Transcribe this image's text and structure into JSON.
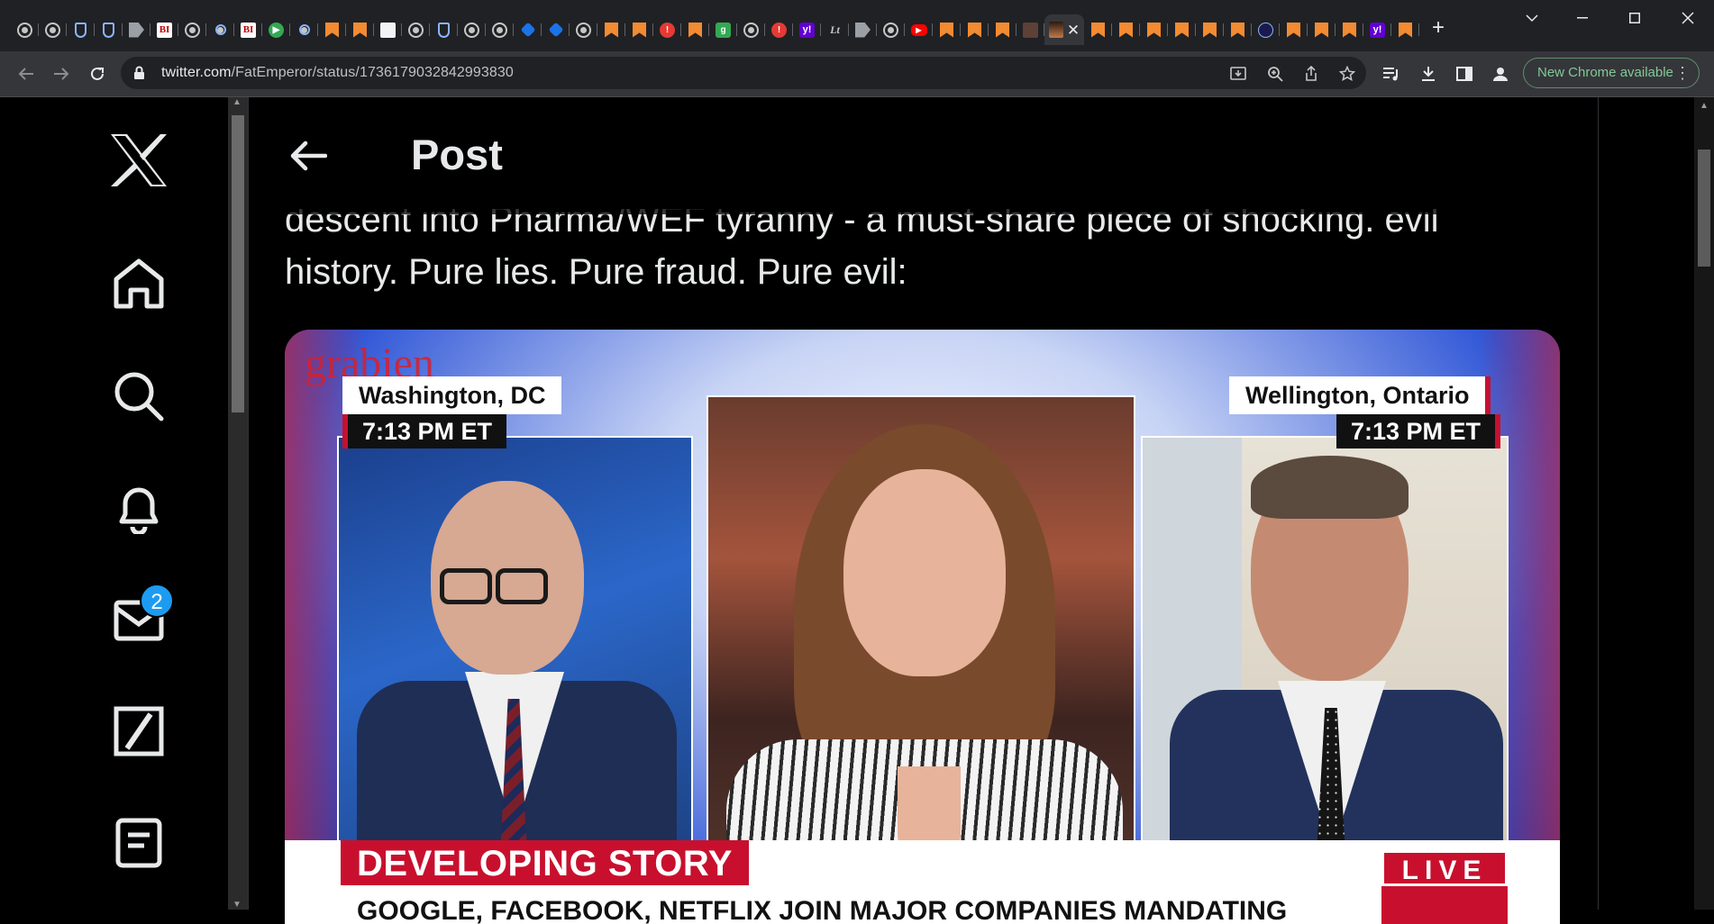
{
  "browser": {
    "tabs": [
      {
        "icon": "globe"
      },
      {
        "icon": "globe"
      },
      {
        "icon": "shield"
      },
      {
        "icon": "shield"
      },
      {
        "icon": "play"
      },
      {
        "icon": "bi",
        "glyph": "BI"
      },
      {
        "icon": "globe"
      },
      {
        "icon": "search"
      },
      {
        "icon": "bi",
        "glyph": "BI"
      },
      {
        "icon": "greenplay",
        "glyph": "▶"
      },
      {
        "icon": "search"
      },
      {
        "icon": "bm"
      },
      {
        "icon": "bm"
      },
      {
        "icon": "white"
      },
      {
        "icon": "globe"
      },
      {
        "icon": "shield"
      },
      {
        "icon": "globe"
      },
      {
        "icon": "globe"
      },
      {
        "icon": "cube"
      },
      {
        "icon": "cube"
      },
      {
        "icon": "globe"
      },
      {
        "icon": "bm"
      },
      {
        "icon": "bm"
      },
      {
        "icon": "red",
        "glyph": "!"
      },
      {
        "icon": "bm"
      },
      {
        "icon": "green",
        "glyph": "g"
      },
      {
        "icon": "globe"
      },
      {
        "icon": "red",
        "glyph": "!"
      },
      {
        "icon": "yahoo",
        "glyph": "y!"
      },
      {
        "icon": "text",
        "glyph": "Lt"
      },
      {
        "icon": "play"
      },
      {
        "icon": "globe"
      },
      {
        "icon": "yt",
        "glyph": "▶"
      },
      {
        "icon": "bm"
      },
      {
        "icon": "bm"
      },
      {
        "icon": "bm"
      },
      {
        "icon": "img"
      },
      {
        "icon": "active"
      },
      {
        "icon": "bm"
      },
      {
        "icon": "bm"
      },
      {
        "icon": "bm"
      },
      {
        "icon": "bm"
      },
      {
        "icon": "bm"
      },
      {
        "icon": "bm"
      },
      {
        "icon": "dark"
      },
      {
        "icon": "bm"
      },
      {
        "icon": "bm"
      },
      {
        "icon": "bm"
      },
      {
        "icon": "yahoo",
        "glyph": "y!"
      },
      {
        "icon": "bm"
      }
    ],
    "active_tab_close": "✕",
    "new_tab": "+",
    "url_host": "twitter.com",
    "url_path": "/FatEmperor/status/1736179032842993830",
    "update_label": "New Chrome available",
    "update_menu": "⋮"
  },
  "sidebar": {
    "messages_badge": "2"
  },
  "post": {
    "header_title": "Post",
    "text_line1": "descent into Pharma/WEF tyranny - a must-share piece of shocking. evil",
    "text_line2": "history. Pure lies. Pure fraud. Pure evil:"
  },
  "video": {
    "watermark": "grabien",
    "left_location": "Washington, DC",
    "left_time": "7:13 PM ET",
    "right_location": "Wellington, Ontario",
    "right_time": "7:13 PM ET",
    "banner": "DEVELOPING STORY",
    "live": "LIVE",
    "ticker": "GOOGLE, FACEBOOK, NETFLIX JOIN MAJOR COMPANIES MANDATING"
  },
  "colors": {
    "twitter_blue": "#1d9bf0",
    "cnn_red": "#c8102e",
    "chrome_update_green": "#81c995"
  }
}
